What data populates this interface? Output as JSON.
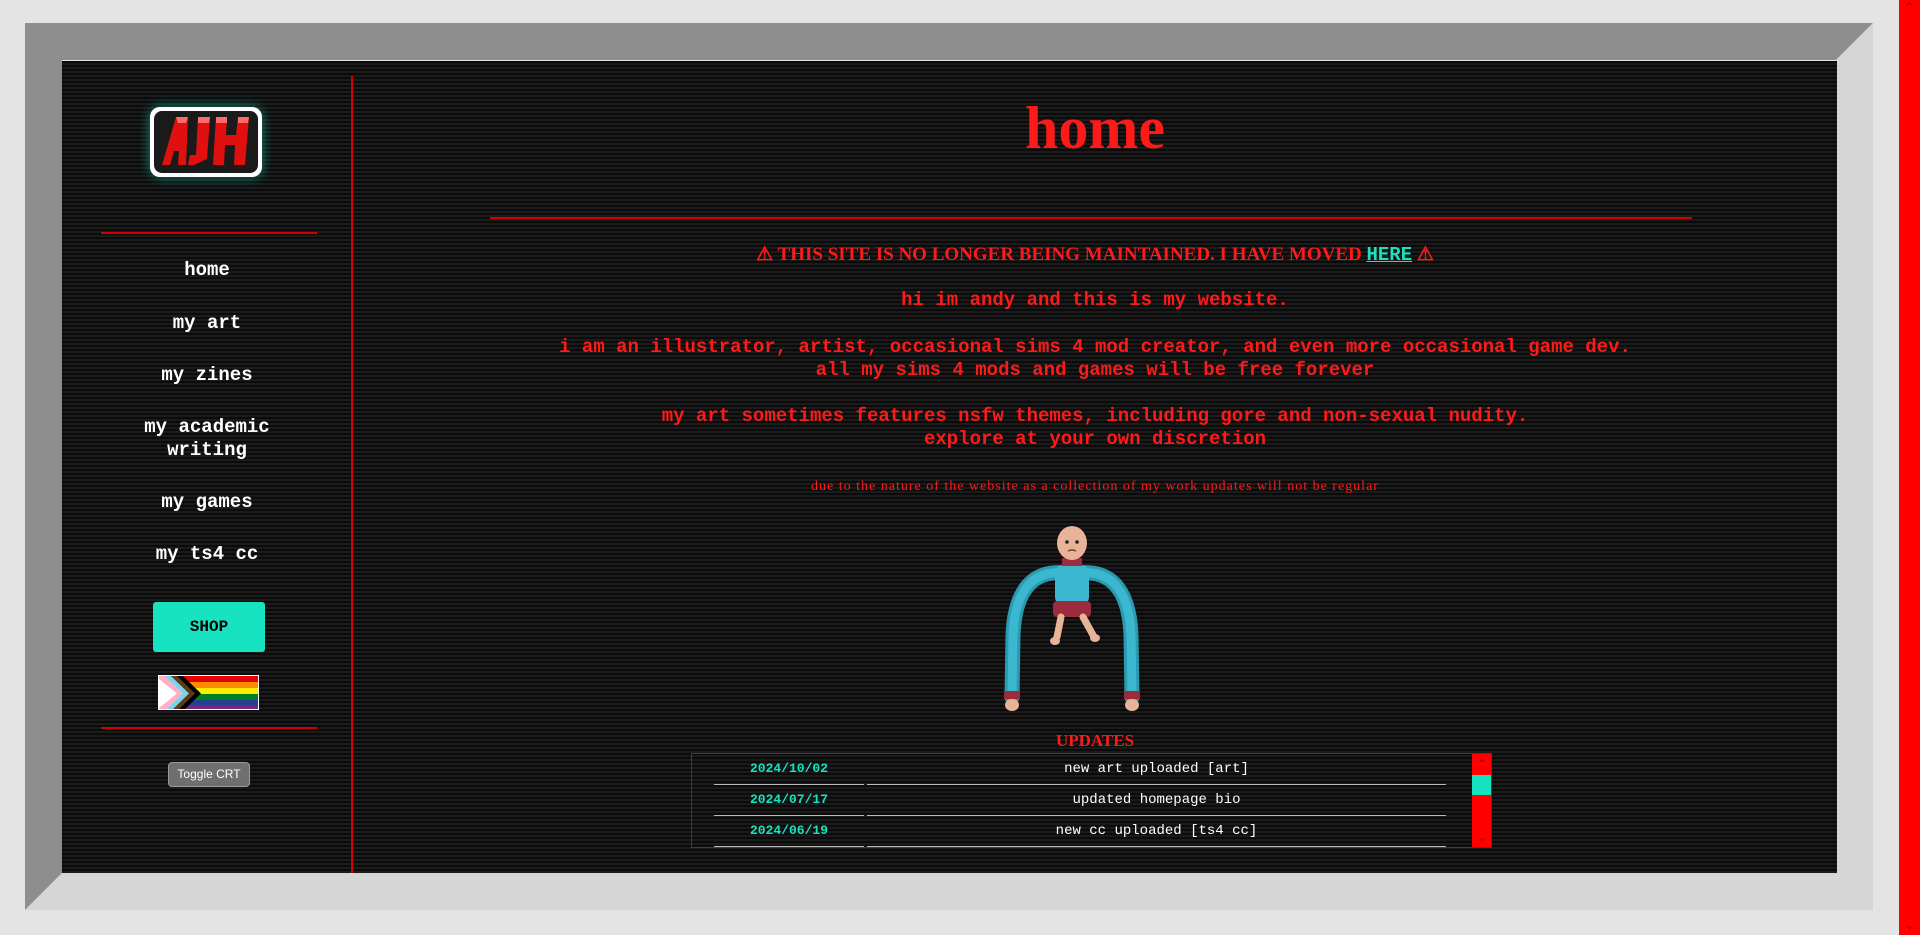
{
  "sidebar": {
    "logo_text": "AJH",
    "nav": [
      {
        "label": "home"
      },
      {
        "label": "my art"
      },
      {
        "label": "my zines"
      },
      {
        "label": "my academic writing"
      },
      {
        "label": "my games"
      },
      {
        "label": "my ts4 cc"
      }
    ],
    "shop_label": "SHOP",
    "toggle_crt_label": "Toggle CRT"
  },
  "main": {
    "title": "home",
    "notice_prefix": "⚠ THIS SITE IS NO LONGER BEING MAINTAINED. I HAVE MOVED ",
    "notice_link": "HERE",
    "notice_suffix": " ⚠",
    "intro": "hi im andy and this is my website.",
    "about_line1": "i am an illustrator, artist, occasional sims 4 mod creator, and even more occasional game dev.",
    "about_line2": "all my sims 4 mods and games will be free forever",
    "nsfw_line1": "my art sometimes features nsfw themes, including gore and non-sexual nudity.",
    "nsfw_line2": "explore at your own discretion",
    "small_note": "due to the nature of the website as a collection of my work updates will not be regular"
  },
  "updates": {
    "heading": "UPDATES",
    "rows": [
      {
        "date": "2024/10/02",
        "text": "new art uploaded [art]"
      },
      {
        "date": "2024/07/17",
        "text": "updated homepage bio"
      },
      {
        "date": "2024/06/19",
        "text": "new cc uploaded [ts4 cc]"
      }
    ]
  },
  "colors": {
    "accent_red": "#ff1a1a",
    "accent_cyan": "#17e3c0",
    "background": "#0b0b0b"
  },
  "icons": {
    "warning": "warning-icon",
    "scroll_up": "chevron-up-icon",
    "scroll_down": "chevron-down-icon"
  }
}
